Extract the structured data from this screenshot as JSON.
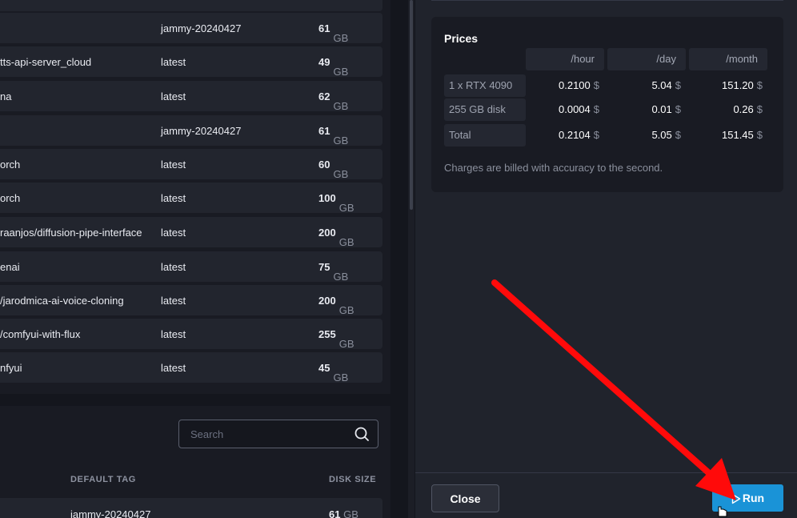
{
  "image_list": {
    "rows": [
      {
        "name": "",
        "tag": "jammy-20240427",
        "size": "61",
        "unit": "GB"
      },
      {
        "name": "tts-api-server_cloud",
        "tag": "latest",
        "size": "49",
        "unit": "GB"
      },
      {
        "name": "na",
        "tag": "latest",
        "size": "62",
        "unit": "GB"
      },
      {
        "name": "",
        "tag": "jammy-20240427",
        "size": "61",
        "unit": "GB"
      },
      {
        "name": "orch",
        "tag": "latest",
        "size": "60",
        "unit": "GB"
      },
      {
        "name": "orch",
        "tag": "latest",
        "size": "100",
        "unit": "GB"
      },
      {
        "name": "raanjos/diffusion-pipe-interface",
        "tag": "latest",
        "size": "200",
        "unit": "GB"
      },
      {
        "name": "enai",
        "tag": "latest",
        "size": "75",
        "unit": "GB"
      },
      {
        "name": "/jarodmica-ai-voice-cloning",
        "tag": "latest",
        "size": "200",
        "unit": "GB"
      },
      {
        "name": "/comfyui-with-flux",
        "tag": "latest",
        "size": "255",
        "unit": "GB"
      },
      {
        "name": "nfyui",
        "tag": "latest",
        "size": "45",
        "unit": "GB"
      }
    ]
  },
  "search": {
    "placeholder": "Search",
    "value": ""
  },
  "table2": {
    "headers": {
      "default_tag": "DEFAULT TAG",
      "disk_size": "DISK SIZE"
    },
    "row": {
      "tag": "jammy-20240427",
      "size": "61",
      "unit": "GB"
    }
  },
  "prices": {
    "title": "Prices",
    "columns": [
      "/hour",
      "/day",
      "/month"
    ],
    "currency": "$",
    "rows": [
      {
        "label": "1 x RTX 4090",
        "hour": "0.2100",
        "day": "5.04",
        "month": "151.20"
      },
      {
        "label": "255 GB disk",
        "hour": "0.0004",
        "day": "0.01",
        "month": "0.26"
      },
      {
        "label": "Total",
        "hour": "0.2104",
        "day": "5.05",
        "month": "151.45"
      }
    ],
    "note": "Charges are billed with accuracy to the second."
  },
  "footer": {
    "close_label": "Close",
    "run_label": "Run"
  },
  "colors": {
    "run_button": "#1a93d7",
    "annotation_arrow": "#ff0a0a"
  },
  "icons": [
    "search-icon",
    "play-icon",
    "hand-cursor-icon",
    "annotation-arrow"
  ]
}
